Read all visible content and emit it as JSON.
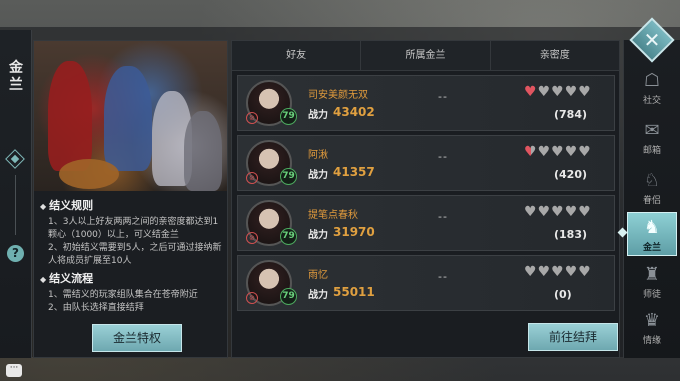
{
  "window": {
    "title": "金兰"
  },
  "rules": {
    "section1_title": "结义规则",
    "section1_lines": [
      "1、3人以上好友两两之间的亲密度都达到1颗心（1000）以上，可义结金兰",
      "2、初始结义需要到5人，之后可通过接纳新人将成员扩展至10人"
    ],
    "section2_title": "结义流程",
    "section2_lines": [
      "1、需结义的玩家组队集合在苍帝附近",
      "2、由队长选择直接结拜"
    ]
  },
  "buttons": {
    "privilege": "金兰特权",
    "goto_sworn": "前往结拜",
    "close": "✕",
    "help": "?",
    "chat": "···"
  },
  "table": {
    "headers": [
      "好友",
      "所属金兰",
      "亲密度"
    ],
    "power_label": "战力",
    "rows": [
      {
        "name": "司安美颜无双",
        "level": "79",
        "power": "43402",
        "jinlan": "--",
        "hearts_full": 1,
        "hearts_half": 0,
        "intimacy": "(784)"
      },
      {
        "name": "阿湫",
        "level": "79",
        "power": "41357",
        "jinlan": "--",
        "hearts_full": 0,
        "hearts_half": 1,
        "intimacy": "(420)"
      },
      {
        "name": "提笔点春秋",
        "level": "79",
        "power": "31970",
        "jinlan": "--",
        "hearts_full": 0,
        "hearts_half": 0,
        "intimacy": "(183)"
      },
      {
        "name": "雨忆",
        "level": "79",
        "power": "55011",
        "jinlan": "--",
        "hearts_full": 0,
        "hearts_half": 0,
        "intimacy": "(0)"
      }
    ]
  },
  "nav": [
    {
      "label": "社交",
      "icon": "chat-bubble-icon",
      "active": false
    },
    {
      "label": "邮箱",
      "icon": "mail-scroll-icon",
      "active": false
    },
    {
      "label": "眷侣",
      "icon": "couple-icon",
      "active": false
    },
    {
      "label": "金兰",
      "icon": "sworn-brothers-icon",
      "active": true
    },
    {
      "label": "师徒",
      "icon": "master-apprentice-icon",
      "active": false
    },
    {
      "label": "情缘",
      "icon": "bond-icon",
      "active": false
    }
  ]
}
